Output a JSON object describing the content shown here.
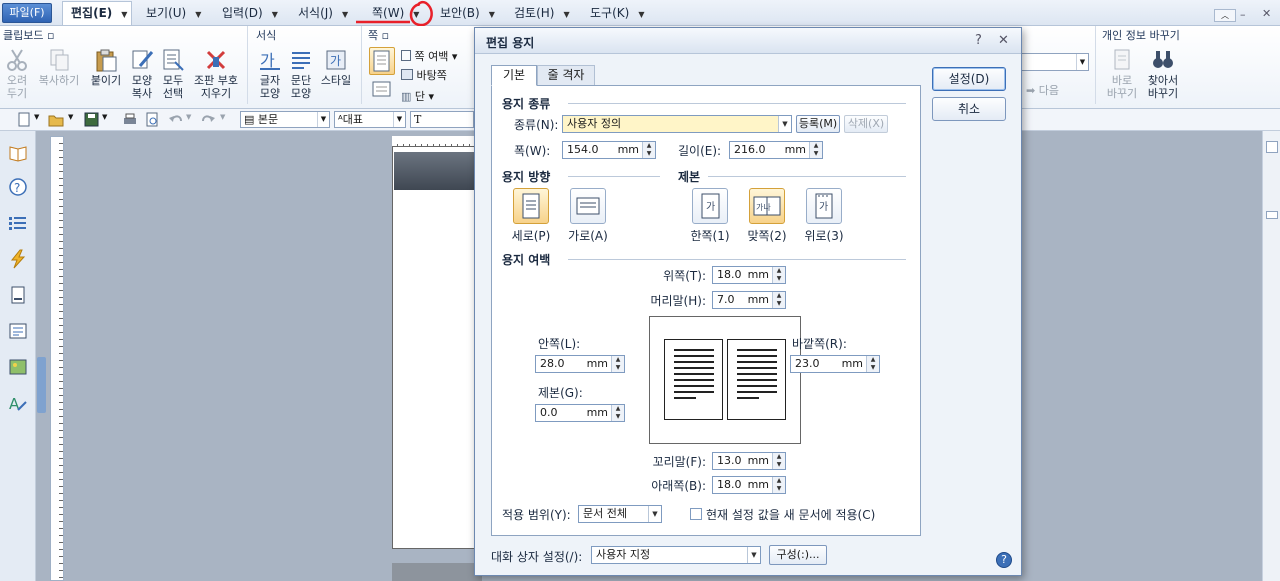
{
  "menubar": {
    "file": "파일(F)",
    "items": [
      "편집(E)",
      "보기(U)",
      "입력(D)",
      "서식(J)",
      "쪽(W)",
      "보안(B)",
      "검토(H)",
      "도구(K)"
    ]
  },
  "ribbon": {
    "clipboard": {
      "title": "클립보드",
      "cut": [
        "오려",
        "두기"
      ],
      "copy": "복사하기",
      "paste": "붙이기",
      "format_copy": [
        "모양",
        "복사"
      ],
      "select_all": [
        "모두",
        "선택"
      ],
      "remove_codes": [
        "조판 부호",
        "지우기"
      ]
    },
    "format": {
      "title": "서식",
      "char_shape": [
        "글자",
        "모양"
      ],
      "para_shape": [
        "문단",
        "모양"
      ],
      "style": "스타일"
    },
    "page": {
      "title": "쪽",
      "page_margin": "쪽 여백",
      "background": "바탕쪽",
      "column": "단"
    },
    "find": {
      "next": "다음"
    },
    "privacy": {
      "title": "개인 정보 바꾸기",
      "replace": [
        "바로",
        "바꾸기"
      ],
      "find_replace": [
        "찾아서",
        "바꾸기"
      ]
    }
  },
  "toolbar": {
    "style_combo": "본문",
    "font_combo": "대표"
  },
  "dialog": {
    "title": "편집 용지",
    "help_glyph": "?",
    "close_glyph": "✕",
    "tabs": [
      "기본",
      "줄 격자"
    ],
    "ok": "설정(D)",
    "cancel": "취소",
    "paper_type": {
      "section": "용지 종류",
      "type_label": "종류(N):",
      "type_value": "사용자 정의",
      "register": "등록(M)",
      "delete": "삭제(X)",
      "width_label": "폭(W):",
      "width_value": "154.0",
      "length_label": "길이(E):",
      "length_value": "216.0",
      "unit": "mm"
    },
    "orientation": {
      "section": "용지 방향",
      "portrait": "세로(P)",
      "landscape": "가로(A)",
      "selected": "portrait"
    },
    "binding": {
      "section": "제본",
      "single": "한쪽(1)",
      "facing": "맞쪽(2)",
      "top": "위로(3)",
      "selected": "facing",
      "icon_text_single": "가",
      "icon_text_facing": "가나",
      "icon_text_top": "가"
    },
    "margins": {
      "section": "용지 여백",
      "top_label": "위쪽(T):",
      "top_value": "18.0",
      "header_label": "머리말(H):",
      "header_value": "7.0",
      "inside_label": "안쪽(L):",
      "inside_value": "28.0",
      "binding_label": "제본(G):",
      "binding_value": "0.0",
      "outside_label": "바깥쪽(R):",
      "outside_value": "23.0",
      "footer_label": "꼬리말(F):",
      "footer_value": "13.0",
      "bottom_label": "아래쪽(B):",
      "bottom_value": "18.0",
      "unit": "mm"
    },
    "apply": {
      "scope_label": "적용 범위(Y):",
      "scope_value": "문서 전체",
      "new_doc_checkbox": "현재 설정 값을 새 문서에 적용(C)",
      "checked": false
    },
    "footer": {
      "setting_label": "대화 상자 설정(/):",
      "setting_value": "사용자 지정",
      "configure": "구성(:)..."
    }
  },
  "colors": {
    "accent": "#2f63b3",
    "selected_option": "#f7d28a",
    "annotation_red": "#e8202a"
  }
}
